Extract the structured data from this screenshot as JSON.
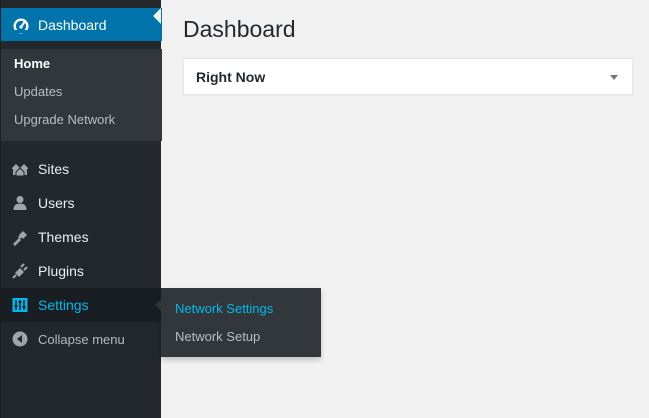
{
  "sidebar": {
    "dashboard": {
      "label": "Dashboard",
      "icon": "dashboard-icon"
    },
    "dashboard_submenu": [
      "Home",
      "Updates",
      "Upgrade Network"
    ],
    "menu": [
      {
        "label": "Sites",
        "icon": "sites-icon"
      },
      {
        "label": "Users",
        "icon": "users-icon"
      },
      {
        "label": "Themes",
        "icon": "themes-icon"
      },
      {
        "label": "Plugins",
        "icon": "plugins-icon"
      },
      {
        "label": "Settings",
        "icon": "settings-icon"
      },
      {
        "label": "Collapse menu",
        "icon": "collapse-icon"
      }
    ]
  },
  "flyout": {
    "items": [
      "Network Settings",
      "Network Setup"
    ]
  },
  "main": {
    "title": "Dashboard",
    "widgets": [
      {
        "title": "Right Now"
      }
    ]
  },
  "colors": {
    "sidebar_bg": "#23282d",
    "submenu_bg": "#32373c",
    "active_bg": "#0073aa",
    "highlight_text": "#00b9eb",
    "page_bg": "#f1f1f1"
  }
}
